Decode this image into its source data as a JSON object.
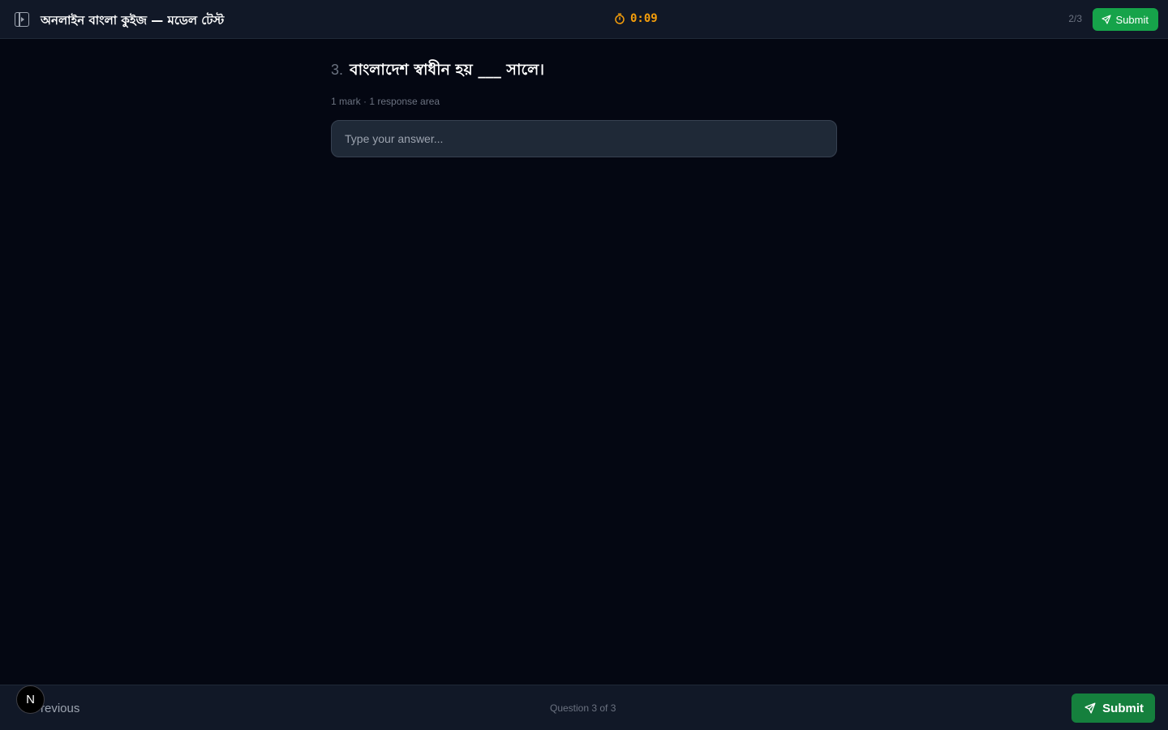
{
  "header": {
    "title": "অনলাইন বাংলা কুইজ — মডেল টেস্ট",
    "timer": "0:09",
    "progress": "2/3",
    "submit_label": "Submit"
  },
  "question": {
    "number": "3.",
    "text": "বাংলাদেশ স্বাধীন হয় ___ সালে।",
    "meta": "1 mark · 1 response area",
    "answer_value": "",
    "answer_placeholder": "Type your answer..."
  },
  "footer": {
    "previous_label": "Previous",
    "status": "Question 3 of 3",
    "submit_label": "Submit",
    "badge_letter": "N"
  },
  "colors": {
    "accent": "#16a34a",
    "timer": "#f59e0b",
    "background": "#040712",
    "bar": "#111827"
  }
}
